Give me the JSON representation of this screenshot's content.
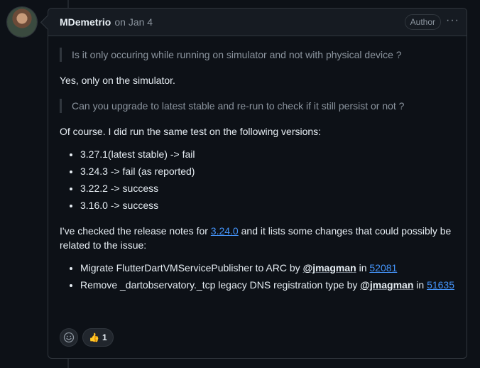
{
  "comment": {
    "author": "MDemetrio",
    "timestamp": "on Jan 4",
    "badge": "Author",
    "quote1": "Is it only occuring while running on simulator and not with physical device ?",
    "reply1": "Yes, only on the simulator.",
    "quote2": "Can you upgrade to latest stable and re-run to check if it still persist or not ?",
    "reply2": "Of course. I did run the same test on the following versions:",
    "versions": [
      "3.27.1(latest stable) -> fail",
      "3.24.3 -> fail (as reported)",
      "3.22.2 -> success",
      "3.16.0 -> success"
    ],
    "notes_pre": "I've checked the release notes for ",
    "notes_link": "3.24.0",
    "notes_post": " and it lists some changes that could possibly be related to the issue:",
    "changes": [
      {
        "text": "Migrate FlutterDartVMServicePublisher to ARC by ",
        "mention": "@jmagman",
        "in": " in ",
        "pr": "52081"
      },
      {
        "text": "Remove _dartobservatory._tcp legacy DNS registration type by ",
        "mention": "@jmagman",
        "in": " in ",
        "pr": "51635"
      }
    ],
    "reactions": {
      "thumbs_up_count": "1",
      "emoji": "👍"
    }
  },
  "icons": {
    "add_reaction": "smiley-icon",
    "more": "kebab-icon"
  },
  "colors": {
    "link": "#4493f8",
    "background": "#0d1117",
    "border": "#30363d"
  }
}
